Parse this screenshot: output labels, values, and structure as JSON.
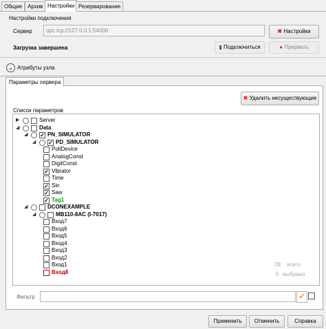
{
  "tabs": [
    "Общие",
    "Архив",
    "Настройки",
    "Резервирование"
  ],
  "connection": {
    "section_title": "Настройки подключения",
    "server_label": "Сервер",
    "server_value": "opc.tcp://127.0.0.1:54000",
    "settings_button": "Настройки",
    "status": "Загрузка завершена",
    "connect_button": "Подключиться",
    "abort_button": "Прервать"
  },
  "node_attributes": "Атрибуты узла",
  "server_params": {
    "tab": "Параметры сервера",
    "delete_missing_button": "Удалить несуществующие",
    "list_title": "Список параметров",
    "tree": [
      {
        "label": "Server",
        "level": 0,
        "expander": true,
        "radio": true,
        "checked": false,
        "style": "normal"
      },
      {
        "label": "Data",
        "level": 0,
        "expander": true,
        "radio": true,
        "checked": false,
        "style": "bold"
      },
      {
        "label": "PN_SIMULATOR",
        "level": 1,
        "expander": true,
        "radio": true,
        "checked": true,
        "style": "bold"
      },
      {
        "label": "PD_SIMULATOR",
        "level": 2,
        "expander": true,
        "radio": true,
        "checked": true,
        "style": "bold"
      },
      {
        "label": "PollDevice",
        "level": 3,
        "expander": false,
        "radio": false,
        "checked": false,
        "style": "normal"
      },
      {
        "label": "AnalogConst",
        "level": 3,
        "expander": false,
        "radio": false,
        "checked": false,
        "style": "normal"
      },
      {
        "label": "DigitConst",
        "level": 3,
        "expander": false,
        "radio": false,
        "checked": false,
        "style": "normal"
      },
      {
        "label": "Vibrator",
        "level": 3,
        "expander": false,
        "radio": false,
        "checked": true,
        "style": "normal"
      },
      {
        "label": "Time",
        "level": 3,
        "expander": false,
        "radio": false,
        "checked": false,
        "style": "normal"
      },
      {
        "label": "Sin",
        "level": 3,
        "expander": false,
        "radio": false,
        "checked": true,
        "style": "normal"
      },
      {
        "label": "Saw",
        "level": 3,
        "expander": false,
        "radio": false,
        "checked": true,
        "style": "normal"
      },
      {
        "label": "Tag1",
        "level": 3,
        "expander": false,
        "radio": false,
        "checked": true,
        "style": "green"
      },
      {
        "label": "DCONEXAMPLE",
        "level": 1,
        "expander": true,
        "radio": true,
        "checked": false,
        "style": "bold"
      },
      {
        "label": "MB110-8AC (I-7017)",
        "level": 2,
        "expander": true,
        "radio": true,
        "checked": false,
        "style": "bold"
      },
      {
        "label": "Вход7",
        "level": 3,
        "expander": false,
        "radio": false,
        "checked": false,
        "style": "normal"
      },
      {
        "label": "Вход6",
        "level": 3,
        "expander": false,
        "radio": false,
        "checked": false,
        "style": "normal"
      },
      {
        "label": "Вход5",
        "level": 3,
        "expander": false,
        "radio": false,
        "checked": false,
        "style": "normal"
      },
      {
        "label": "Вход4",
        "level": 3,
        "expander": false,
        "radio": false,
        "checked": false,
        "style": "normal"
      },
      {
        "label": "Вход3",
        "level": 3,
        "expander": false,
        "radio": false,
        "checked": false,
        "style": "normal"
      },
      {
        "label": "Вход2",
        "level": 3,
        "expander": false,
        "radio": false,
        "checked": false,
        "style": "normal"
      },
      {
        "label": "Вход1",
        "level": 3,
        "expander": false,
        "radio": false,
        "checked": false,
        "style": "normal"
      },
      {
        "label": "Вход8",
        "level": 3,
        "expander": false,
        "radio": false,
        "checked": false,
        "style": "red"
      }
    ],
    "stats": {
      "total_count": "28",
      "total_label": "всего",
      "selected_count": "5",
      "selected_label": "выбрано"
    },
    "filter_label": "Фильтр",
    "filter_value": ""
  },
  "footer": {
    "apply": "Применить",
    "cancel": "Отменить",
    "help": "Справка"
  },
  "colors": {
    "accent_green": "#00a000",
    "error_red": "#c00000",
    "delete_icon": "#e03030",
    "filter_check": "#e87a1c"
  },
  "icons": {
    "settings": "tools-icon",
    "connect": "plug-icon",
    "abort": "stop-icon",
    "delete": "red-x-icon",
    "expand": "chevron-down-circle-icon",
    "filter_apply": "checkmark-icon"
  }
}
